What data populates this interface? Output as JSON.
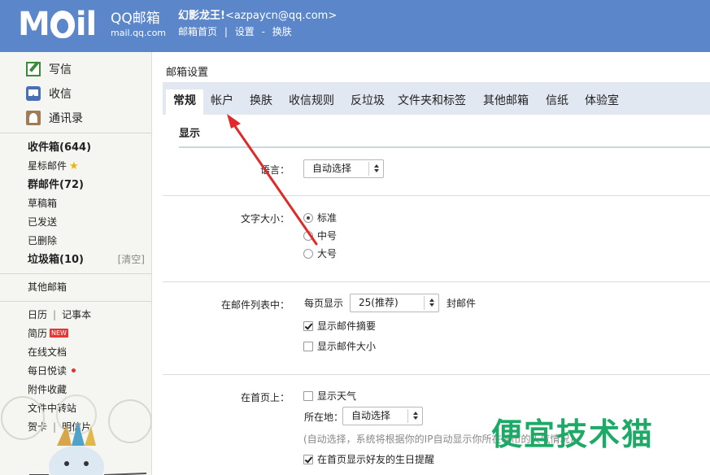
{
  "header": {
    "logo_text": "M",
    "logo_text_end": "il",
    "brand": "QQ邮箱",
    "domain": "mail.qq.com",
    "user_name": "幻影龙王!",
    "user_email": "<azpaycn@qq.com>",
    "links": [
      "邮箱首页",
      "设置",
      "换肤"
    ],
    "link_sep": "|",
    "link_dash": "-"
  },
  "sidebar": {
    "actions": [
      {
        "label": "写信",
        "icon": "compose-icon"
      },
      {
        "label": "收信",
        "icon": "inbox-icon"
      },
      {
        "label": "通讯录",
        "icon": "contacts-icon"
      }
    ],
    "folders": [
      {
        "label": "收件箱(644)",
        "bold": true
      },
      {
        "label": "星标邮件",
        "star": "★"
      },
      {
        "label": "群邮件(72)",
        "bold": true
      },
      {
        "label": "草稿箱"
      },
      {
        "label": "已发送"
      },
      {
        "label": "已删除"
      },
      {
        "label": "垃圾箱(10)",
        "bold": true,
        "clear": "[清空]"
      }
    ],
    "other_mailbox": "其他邮箱",
    "calendar": "日历",
    "notebook": "记事本",
    "resume": "简历",
    "new_badge": "NEW",
    "online_docs": "在线文档",
    "daily_read": "每日悦读",
    "attachments": "附件收藏",
    "file_transfer": "文件中转站",
    "greeting_card": "贺卡",
    "postcard": "明信片",
    "pipe": "|"
  },
  "main": {
    "title": "邮箱设置",
    "tabs": [
      "常规",
      "帐户",
      "换肤",
      "收信规则",
      "反垃圾",
      "文件夹和标签",
      "其他邮箱",
      "信纸",
      "体验室"
    ],
    "active_tab": 0,
    "section": "显示",
    "language": {
      "label": "语言：",
      "value": "自动选择"
    },
    "font_size": {
      "label": "文字大小：",
      "options": [
        "标准",
        "中号",
        "大号"
      ],
      "selected": 0
    },
    "mail_list": {
      "label": "在邮件列表中：",
      "per_page_prefix": "每页显示",
      "per_page_value": "25(推荐)",
      "per_page_suffix": "封邮件",
      "show_summary": "显示邮件摘要",
      "show_size": "显示邮件大小"
    },
    "homepage": {
      "label": "在首页上：",
      "show_weather": "显示天气",
      "location_label": "所在地：",
      "location_value": "自动选择",
      "hint": "(自动选择，系统将根据你的IP自动显示你所在城市的天气情况)",
      "birthday": "在首页显示好友的生日提醒"
    }
  },
  "watermark": "便宜技术猫",
  "colors": {
    "header_bg": "#5b86c9",
    "tab_bar_bg": "#e2e8f2",
    "annotation_arrow": "#e02a2a",
    "watermark": "#1caa66"
  }
}
